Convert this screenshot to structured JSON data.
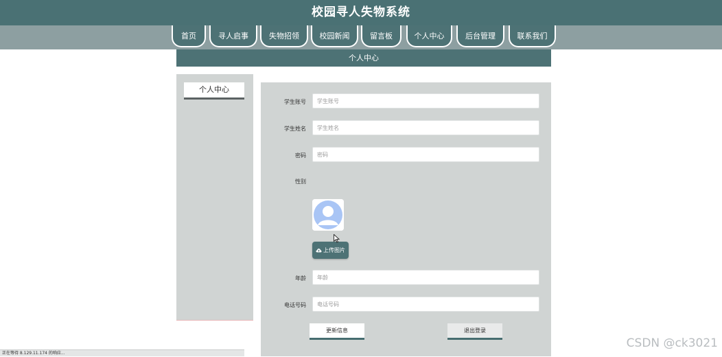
{
  "header": {
    "title": "校园寻人失物系统"
  },
  "nav": {
    "tabs": [
      {
        "label": "首页"
      },
      {
        "label": "寻人启事"
      },
      {
        "label": "失物招领"
      },
      {
        "label": "校园新闻"
      },
      {
        "label": "留言板"
      },
      {
        "label": "个人中心"
      },
      {
        "label": "后台管理"
      },
      {
        "label": "联系我们"
      }
    ]
  },
  "subheader": {
    "title": "个人中心"
  },
  "sidebar": {
    "items": [
      {
        "label": "个人中心"
      }
    ]
  },
  "form": {
    "account": {
      "label": "学生账号",
      "placeholder": "学生账号"
    },
    "name": {
      "label": "学生姓名",
      "placeholder": "学生姓名"
    },
    "password": {
      "label": "密码",
      "placeholder": "密码"
    },
    "gender": {
      "label": "性别"
    },
    "upload": {
      "label": "上传图片"
    },
    "age": {
      "label": "年龄",
      "placeholder": "年龄"
    },
    "phone": {
      "label": "电话号码",
      "placeholder": "电话号码"
    },
    "update_label": "更新信息",
    "logout_label": "退出登录"
  },
  "statusbar": {
    "text": "正在等待 8.129.11.174 的响应..."
  },
  "watermark": {
    "text": "CSDN @ck3021"
  },
  "colors": {
    "primary": "#4a7174",
    "nav_bg": "#8d9fa1",
    "panel_bg": "#d0d4d3",
    "avatar_blue": "#a9c5f5"
  }
}
